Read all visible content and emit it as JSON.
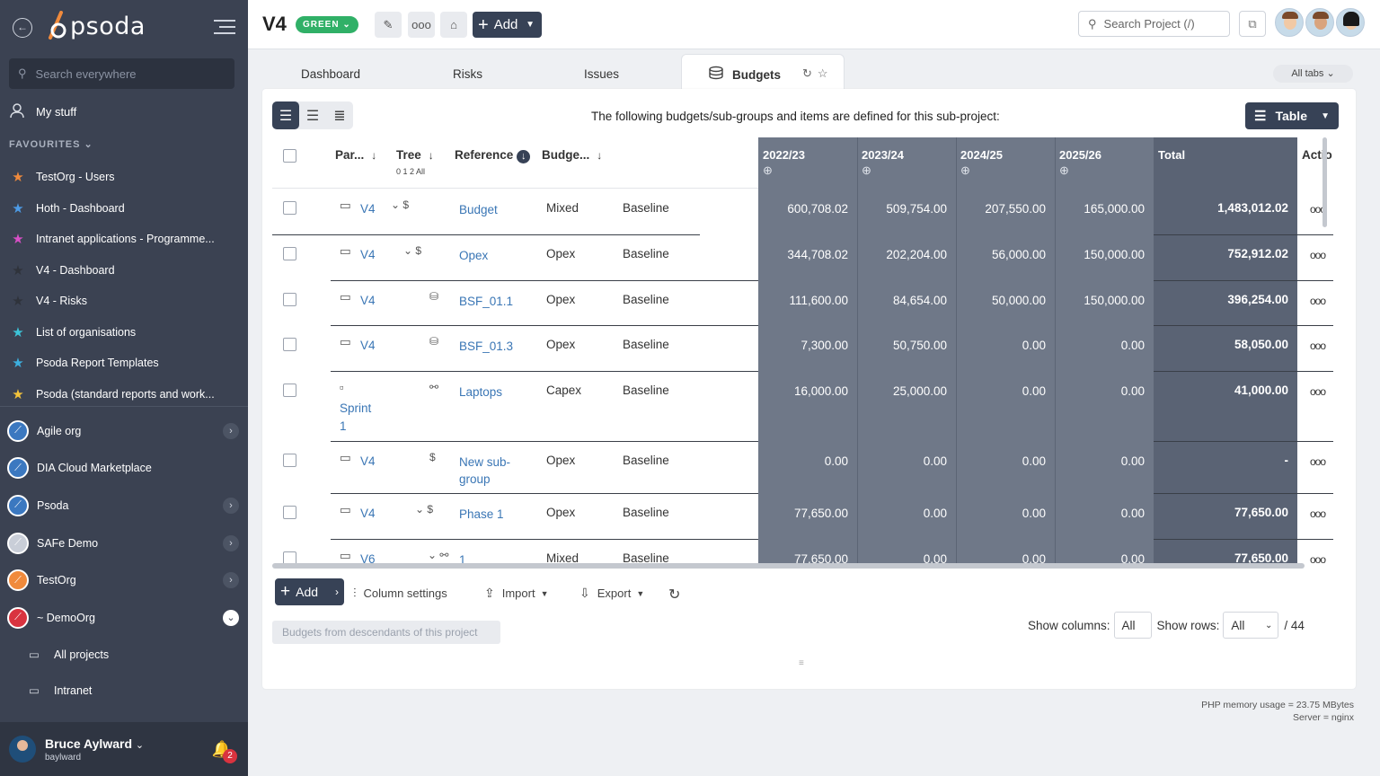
{
  "sidebar": {
    "logo": "psoda",
    "search_placeholder": "Search everywhere",
    "my_stuff": "My stuff",
    "favourites_heading": "FAVOURITES",
    "favourites": [
      {
        "label": "TestOrg - Users",
        "color": "#f08a3c"
      },
      {
        "label": "Hoth - Dashboard",
        "color": "#4d9be6"
      },
      {
        "label": "Intranet applications - Programme...",
        "color": "#d84fc6"
      },
      {
        "label": "V4 - Dashboard",
        "color": "#2f333b"
      },
      {
        "label": "V4 - Risks",
        "color": "#2f333b"
      },
      {
        "label": "List of organisations",
        "color": "#3cc4d8"
      },
      {
        "label": "Psoda Report Templates",
        "color": "#3cb0e0"
      },
      {
        "label": "Psoda (standard reports and work...",
        "color": "#f3c33b"
      }
    ],
    "orgs": [
      {
        "label": "Agile org",
        "color": "#3b78c0",
        "chevron": "›"
      },
      {
        "label": "DIA Cloud Marketplace",
        "color": "#3b78c0",
        "chevron": ""
      },
      {
        "label": "Psoda",
        "color": "#3b78c0",
        "chevron": "›"
      },
      {
        "label": "SAFe Demo",
        "color": "#c9ced8",
        "chevron": "›"
      },
      {
        "label": "TestOrg",
        "color": "#f08a3c",
        "chevron": "›"
      },
      {
        "label": "~ DemoOrg",
        "color": "#d9333f",
        "chevron": "⌄"
      }
    ],
    "sub_items": [
      "All projects",
      "Intranet"
    ],
    "user": {
      "name": "Bruce Aylward",
      "handle": "baylward",
      "notifications": "2"
    }
  },
  "topbar": {
    "title": "V4",
    "status": "GREEN",
    "add_label": "Add",
    "search_placeholder": "Search Project (/)"
  },
  "tabs": {
    "items": [
      "Dashboard",
      "Risks",
      "Issues"
    ],
    "active": "Budgets",
    "all_tabs": "All tabs"
  },
  "card": {
    "caption": "The following budgets/sub-groups and items are defined for this sub-project:",
    "view_button": "Table",
    "columns": {
      "parent": "Par...",
      "tree": "Tree",
      "tree_levels": "0 1 2 All",
      "reference": "Reference",
      "budget": "Budge...",
      "years": [
        "2022/23",
        "2023/24",
        "2024/25",
        "2025/26"
      ],
      "total": "Total",
      "actions": "Actio"
    },
    "rows": [
      {
        "parent": "V4",
        "parent_extra": "",
        "ref": "Budget",
        "ref2": "",
        "type": "Mixed",
        "baseline": "Baseline",
        "y": [
          "600,708.02",
          "509,754.00",
          "207,550.00",
          "165,000.00"
        ],
        "total": "1,483,012.02"
      },
      {
        "parent": "V4",
        "parent_extra": "",
        "ref": "Opex",
        "ref2": "",
        "type": "Opex",
        "baseline": "Baseline",
        "y": [
          "344,708.02",
          "202,204.00",
          "56,000.00",
          "150,000.00"
        ],
        "total": "752,912.02"
      },
      {
        "parent": "V4",
        "parent_extra": "",
        "ref": "BSF_01.1",
        "ref2": "",
        "type": "Opex",
        "baseline": "Baseline",
        "y": [
          "111,600.00",
          "84,654.00",
          "50,000.00",
          "150,000.00"
        ],
        "total": "396,254.00"
      },
      {
        "parent": "V4",
        "parent_extra": "",
        "ref": "BSF_01.3",
        "ref2": "",
        "type": "Opex",
        "baseline": "Baseline",
        "y": [
          "7,300.00",
          "50,750.00",
          "0.00",
          "0.00"
        ],
        "total": "58,050.00"
      },
      {
        "parent": "Sprint",
        "parent_extra": "1",
        "ref": "Laptops",
        "ref2": "",
        "type": "Capex",
        "baseline": "Baseline",
        "y": [
          "16,000.00",
          "25,000.00",
          "0.00",
          "0.00"
        ],
        "total": "41,000.00"
      },
      {
        "parent": "V4",
        "parent_extra": "",
        "ref": "New sub-",
        "ref2": "group",
        "type": "Opex",
        "baseline": "Baseline",
        "y": [
          "0.00",
          "0.00",
          "0.00",
          "0.00"
        ],
        "total": "-"
      },
      {
        "parent": "V4",
        "parent_extra": "",
        "ref": "Phase 1",
        "ref2": "",
        "type": "Opex",
        "baseline": "Baseline",
        "y": [
          "77,650.00",
          "0.00",
          "0.00",
          "0.00"
        ],
        "total": "77,650.00"
      },
      {
        "parent": "V6",
        "parent_extra": "",
        "ref": "1",
        "ref2": "",
        "type": "Mixed",
        "baseline": "Baseline",
        "y": [
          "77,650.00",
          "0.00",
          "0.00",
          "0.00"
        ],
        "total": "77,650.00"
      }
    ],
    "footer": {
      "add": "Add",
      "column_settings": "Column settings",
      "import": "Import",
      "export": "Export",
      "show_columns_label": "Show columns:",
      "show_columns_value": "All",
      "show_rows_label": "Show rows:",
      "show_rows_value": "All",
      "row_count": "/ 44",
      "descendants": "Budgets from descendants of this project"
    }
  },
  "meta": {
    "memory": "PHP memory usage = 23.75 MBytes",
    "server": "Server = nginx"
  }
}
